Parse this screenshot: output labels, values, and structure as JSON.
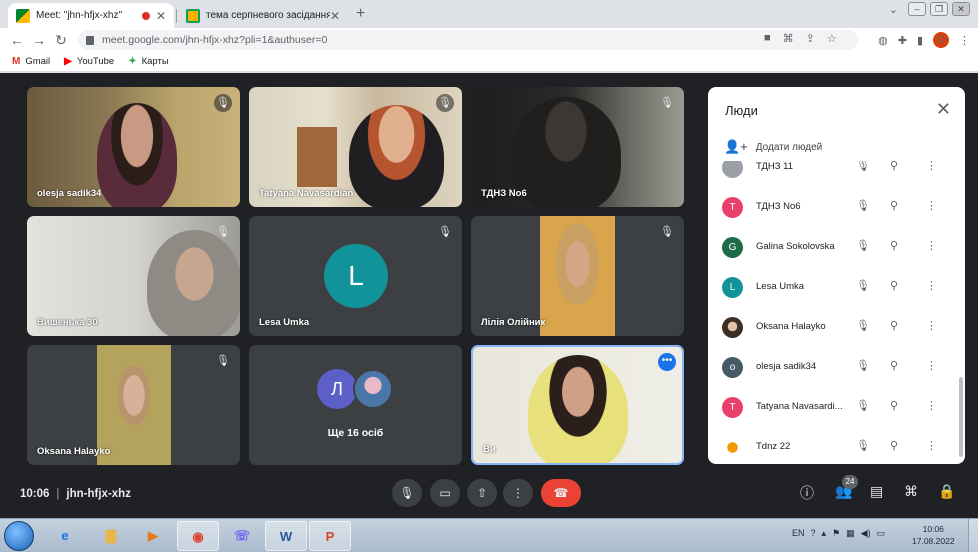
{
  "browser": {
    "tabs": [
      {
        "title": "Meet: \"jhn-hfjx-xhz\"",
        "active": true
      },
      {
        "title": "тема серпневого засідання дл",
        "active": false
      }
    ],
    "new_tab_glyph": "+",
    "url": "meet.google.com/jhn-hfjx-xhz?pli=1&authuser=0",
    "profile_initial": "O",
    "bookmarks": [
      {
        "label": "Gmail",
        "icon": "gmail-icon"
      },
      {
        "label": "YouTube",
        "icon": "youtube-icon"
      },
      {
        "label": "Карты",
        "icon": "maps-icon"
      }
    ]
  },
  "meet": {
    "tiles": [
      {
        "name": "olesja sadik34",
        "type": "video"
      },
      {
        "name": "Tatyana Navasardian",
        "type": "video"
      },
      {
        "name": "ТДНЗ No6",
        "type": "video"
      },
      {
        "name": "Вишенька 30",
        "type": "video"
      },
      {
        "name": "Lesa Umka",
        "type": "avatar",
        "initial": "L"
      },
      {
        "name": "Лілія Олійник",
        "type": "video"
      },
      {
        "name": "Oksana Halayko",
        "type": "video"
      },
      {
        "name": "Ще 16 осіб",
        "type": "group",
        "initial": "Л"
      },
      {
        "name": "Ви",
        "type": "self"
      }
    ],
    "time": "10:06",
    "meeting_code": "jhn-hfjx-xhz",
    "participant_count": "24"
  },
  "people_panel": {
    "title": "Люди",
    "add_people": "Додати людей",
    "participants": [
      {
        "name": "ТДНЗ 11",
        "initial": "",
        "color": "#9aa0a6"
      },
      {
        "name": "ТДНЗ No6",
        "initial": "Т",
        "color": "#e8406b"
      },
      {
        "name": "Galina Sokolovska",
        "initial": "G",
        "color": "#1e6b47"
      },
      {
        "name": "Lesa Umka",
        "initial": "L",
        "color": "#12939a"
      },
      {
        "name": "Oksana Halayko",
        "initial": "",
        "color": "#6d5a48"
      },
      {
        "name": "olesja sadik34",
        "initial": "o",
        "color": "#455a64"
      },
      {
        "name": "Tatyana Navasardi...",
        "initial": "T",
        "color": "#e8406b"
      },
      {
        "name": "Tdnz 22",
        "initial": "",
        "color": "#f29900"
      }
    ]
  },
  "taskbar": {
    "lang": "EN",
    "time": "10:06",
    "date": "17.08.2022"
  }
}
